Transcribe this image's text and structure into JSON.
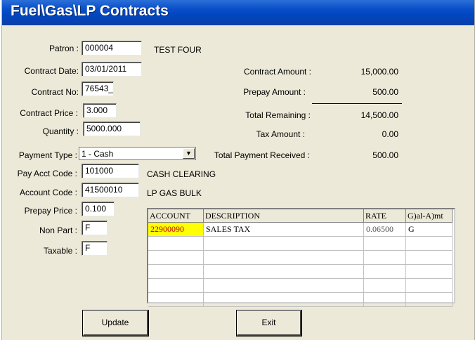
{
  "window": {
    "title": "Fuel\\Gas\\LP Contracts"
  },
  "form": {
    "patron_label": "Patron :",
    "patron_value": "000004",
    "patron_name": "TEST FOUR",
    "contract_date_label": "Contract Date:",
    "contract_date_value": "03/01/2011",
    "contract_no_label": "Contract No:",
    "contract_no_value": "76543_",
    "contract_price_label": "Contract Price :",
    "contract_price_value": "3.000",
    "quantity_label": "Quantity :",
    "quantity_value": "5000.000",
    "payment_type_label": "Payment Type :",
    "payment_type_value": "1 - Cash",
    "pay_acct_code_label": "Pay Acct Code :",
    "pay_acct_code_value": "101000",
    "pay_acct_code_desc": "CASH CLEARING",
    "account_code_label": "Account Code :",
    "account_code_value": "41500010",
    "account_code_desc": "LP GAS BULK",
    "prepay_price_label": "Prepay Price :",
    "prepay_price_value": "0.100",
    "non_part_label": "Non Part :",
    "non_part_value": "F",
    "taxable_label": "Taxable :",
    "taxable_value": "F"
  },
  "summary": {
    "contract_amount_label": "Contract Amount :",
    "contract_amount_value": "15,000.00",
    "prepay_amount_label": "Prepay Amount :",
    "prepay_amount_value": "500.00",
    "total_remaining_label": "Total Remaining :",
    "total_remaining_value": "14,500.00",
    "tax_amount_label": "Tax Amount :",
    "tax_amount_value": "0.00",
    "total_payment_label": "Total Payment Received :",
    "total_payment_value": "500.00"
  },
  "tax_grid": {
    "columns": [
      "ACCOUNT",
      "DESCRIPTION",
      "RATE",
      "G)al-A)mt"
    ],
    "rows": [
      [
        "22900090",
        "SALES TAX",
        "0.06500",
        "G"
      ],
      [
        "",
        "",
        "",
        ""
      ],
      [
        "",
        "",
        "",
        ""
      ],
      [
        "",
        "",
        "",
        ""
      ],
      [
        "",
        "",
        "",
        ""
      ],
      [
        "",
        "",
        "",
        ""
      ]
    ]
  },
  "buttons": {
    "update_label": "Update",
    "exit_label": "Exit"
  },
  "colors": {
    "titlebar": "#0A4FC8",
    "face": "#ECE9D8",
    "highlight": "#FFFF00"
  }
}
